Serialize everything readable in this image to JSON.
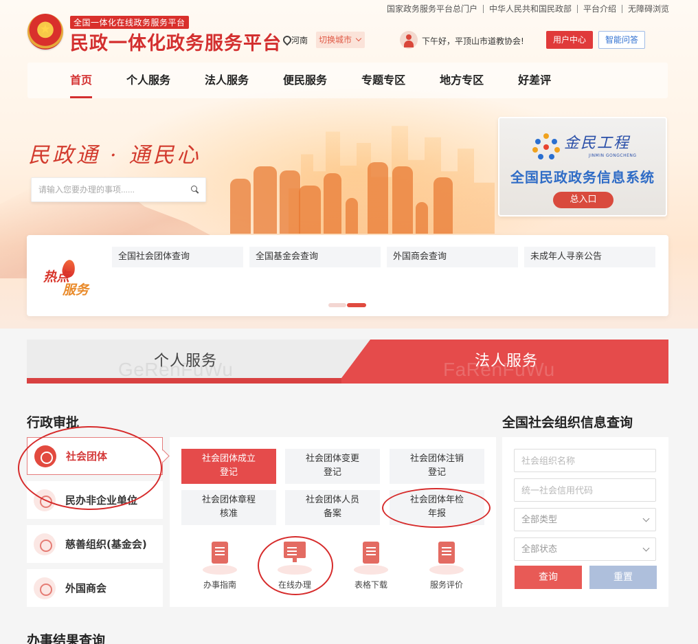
{
  "top_links": [
    "国家政务服务平台总门户",
    "中华人民共和国民政部",
    "平台介绍",
    "无障碍浏览"
  ],
  "header": {
    "platform_tag": "全国一体化在线政务服务平台",
    "title": "民政一体化政务服务平台",
    "location": "河南",
    "switch_city": "切换城市",
    "greeting": "下午好，平顶山市道教协会!",
    "user_center": "用户中心",
    "ai_assistant": "智能问答"
  },
  "nav": [
    {
      "label": "首页",
      "active": true
    },
    {
      "label": "个人服务"
    },
    {
      "label": "法人服务"
    },
    {
      "label": "便民服务"
    },
    {
      "label": "专题专区"
    },
    {
      "label": "地方专区"
    },
    {
      "label": "好差评"
    }
  ],
  "banner": {
    "slogan": "民政通 · 通民心",
    "search_placeholder": "请输入您要办理的事项......",
    "jinmin_name": "金民工程",
    "jinmin_pinyin": "JINMIN GONGCHENG",
    "jinmin_title": "全国民政政务信息系统",
    "jinmin_button": "总入口"
  },
  "hot_services": {
    "logo_line1": "热点",
    "logo_line2": "服务",
    "items": [
      "全国社会团体查询",
      "全国基金会查询",
      "外国商会查询",
      "未成年人寻亲公告"
    ],
    "active_dot": 1
  },
  "service_tabs": {
    "personal": "个人服务",
    "personal_pinyin": "GeRenFuWu",
    "corporate": "法人服务",
    "corporate_pinyin": "FaRenFuWu",
    "active": "corporate"
  },
  "admin_approval": {
    "heading": "行政审批",
    "categories": [
      {
        "label": "社会团体",
        "active": true
      },
      {
        "label": "民办非企业单位"
      },
      {
        "label": "慈善组织(基金会)"
      },
      {
        "label": "外国商会"
      }
    ],
    "matters": [
      {
        "line1": "社会团体成立",
        "line2": "登记",
        "active": true
      },
      {
        "line1": "社会团体变更",
        "line2": "登记"
      },
      {
        "line1": "社会团体注销",
        "line2": "登记"
      },
      {
        "line1": "社会团体章程",
        "line2": "核准"
      },
      {
        "line1": "社会团体人员",
        "line2": "备案"
      },
      {
        "line1": "社会团体年检",
        "line2": "年报"
      }
    ],
    "tools": [
      "办事指南",
      "在线办理",
      "表格下载",
      "服务评价"
    ]
  },
  "org_query": {
    "heading": "全国社会组织信息查询",
    "name_placeholder": "社会组织名称",
    "code_placeholder": "统一社会信用代码",
    "type_select": "全部类型",
    "status_select": "全部状态",
    "query_button": "查询",
    "reset_button": "重置"
  },
  "result_query": {
    "heading": "办事结果查询"
  },
  "colors": {
    "primary_red": "#e54b4b",
    "title_red": "#d32f2f",
    "reset_blue": "#aebfdc",
    "annotation_red": "#d62b2b"
  }
}
